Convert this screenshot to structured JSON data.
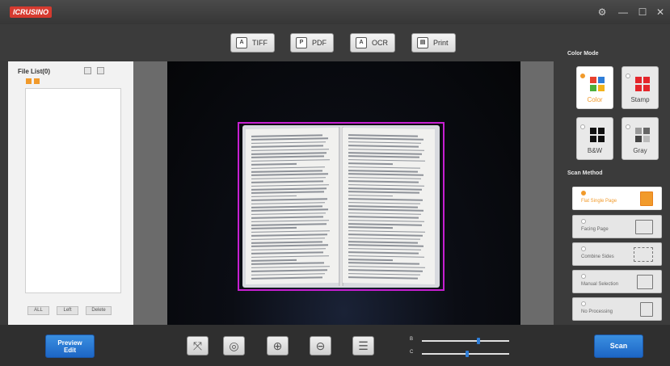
{
  "title_bar": {
    "app_logo": "ICRUSINO",
    "app_subtitle": "",
    "controls": [
      "settings-icon",
      "minimize-icon",
      "maximize-icon",
      "close-icon"
    ]
  },
  "toolbar": {
    "buttons": [
      {
        "label": "TIFF",
        "icon": "tiff-icon"
      },
      {
        "label": "PDF",
        "icon": "pdf-icon"
      },
      {
        "label": "OCR",
        "icon": "ocr-icon"
      },
      {
        "label": "Print",
        "icon": "printer-icon"
      }
    ]
  },
  "left_panel": {
    "title": "File List(0)",
    "buttons": [
      "ALL",
      "Left",
      "Delete"
    ]
  },
  "preview": {
    "crop_border_color": "#c61fd1"
  },
  "right_panel": {
    "color_mode_title": "Color Mode",
    "color_modes": [
      {
        "label": "Color",
        "selected": true
      },
      {
        "label": "Stamp",
        "selected": false
      },
      {
        "label": "B&W",
        "selected": false
      },
      {
        "label": "Gray",
        "selected": false
      }
    ],
    "scan_method_title": "Scan Method",
    "scan_methods": [
      {
        "label": "Flat Single Page",
        "selected": true
      },
      {
        "label": "Facing Page",
        "selected": false
      },
      {
        "label": "Combine Sides",
        "selected": false
      },
      {
        "label": "Manual Selection",
        "selected": false
      },
      {
        "label": "No Processing",
        "selected": false
      }
    ]
  },
  "bottom_bar": {
    "preview_edit_label_1": "Preview",
    "preview_edit_label_2": "Edit",
    "tools": [
      "fit-screen-icon",
      "rotate-icon",
      "zoom-in-icon",
      "zoom-out-icon",
      "adjust-icon"
    ],
    "sliders": [
      {
        "label": "B",
        "value": 0.65
      },
      {
        "label": "C",
        "value": 0.52
      }
    ],
    "scan_label": "Scan"
  },
  "colors": {
    "accent_orange": "#f19a2b",
    "primary_blue": "#2f7ed8",
    "crop_magenta": "#c61fd1"
  }
}
